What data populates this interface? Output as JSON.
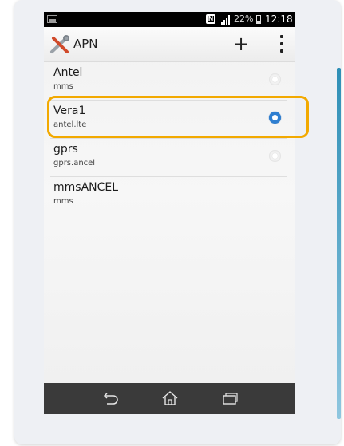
{
  "status_bar": {
    "battery_percent": "22%",
    "time": "12:18"
  },
  "action_bar": {
    "title": "APN",
    "add_label": "+",
    "icons": [
      "tools-icon",
      "overflow-menu-icon"
    ]
  },
  "apn_list": [
    {
      "name": "Antel",
      "detail": "mms",
      "selected": false
    },
    {
      "name": "Vera1",
      "detail": "antel.lte",
      "selected": true
    },
    {
      "name": "gprs",
      "detail": "gprs.ancel",
      "selected": false
    },
    {
      "name": "mmsANCEL",
      "detail": "mms",
      "selected": null
    }
  ],
  "nav_bar": {
    "icons": [
      "back-icon",
      "home-icon",
      "recent-apps-icon"
    ]
  },
  "colors": {
    "highlight": "#f2a900",
    "selected_radio": "#2f7fd1",
    "accent_edge": "#2e8fb6"
  }
}
